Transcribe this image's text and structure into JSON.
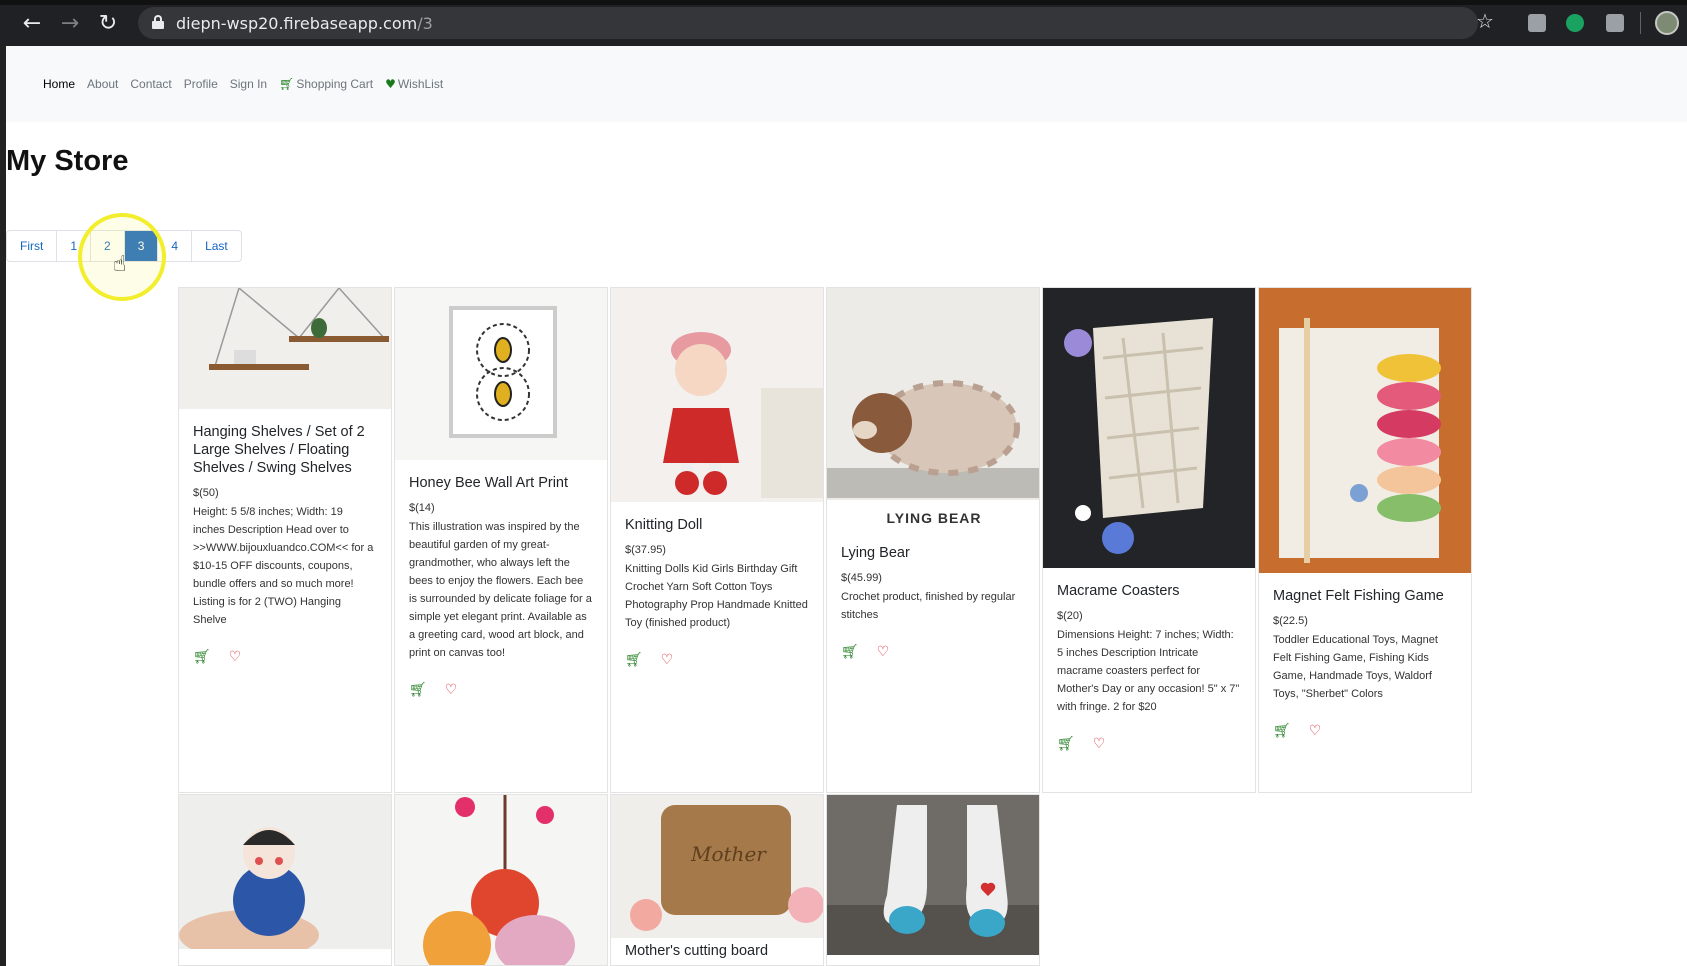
{
  "browser": {
    "url_host": "diepn-wsp20.firebaseapp.com",
    "url_path": "/3"
  },
  "nav": {
    "items": [
      "Home",
      "About",
      "Contact",
      "Profile",
      "Sign In"
    ],
    "cart_label": "Shopping Cart",
    "wishlist_label": "WishList"
  },
  "page": {
    "title": "My Store"
  },
  "pagination": {
    "first": "First",
    "pages": [
      "1",
      "2",
      "3",
      "4"
    ],
    "current": "3",
    "last": "Last"
  },
  "products": [
    {
      "name": "Hanging Shelves / Set of 2 Large Shelves / Floating Shelves / Swing Shelves",
      "price": "$(50)",
      "description": "Height: 5 5/8 inches; Width: 19 inches Description Head over to >>WWW.bijouxluandco.COM<< for a $10-15 OFF discounts, coupons, bundle offers and so much more! Listing is for 2 (TWO) Hanging Shelve"
    },
    {
      "name": "Honey Bee Wall Art Print",
      "price": "$(14)",
      "description": "This illustration was inspired by the beautiful garden of my great-grandmother, who always left the bees to enjoy the flowers. Each bee is surrounded by delicate foliage for a simple yet elegant print. Available as a greeting card, wood art block, and print on canvas too!"
    },
    {
      "name": "Knitting Doll",
      "price": "$(37.95)",
      "description": "Knitting Dolls Kid Girls Birthday Gift Crochet Yarn Soft Cotton Toys Photography Prop Handmade Knitted Toy (finished product)"
    },
    {
      "name": "Lying Bear",
      "price": "$(45.99)",
      "description": "Crochet product, finished by regular stitches",
      "image_caption": "LYING BEAR"
    },
    {
      "name": "Macrame Coasters",
      "price": "$(20)",
      "description": "Dimensions Height: 7 inches; Width: 5 inches Description Intricate macrame coasters perfect for Mother's Day or any occasion! 5\" x 7\" with fringe. 2 for $20"
    },
    {
      "name": "Magnet Felt Fishing Game",
      "price": "$(22.5)",
      "description": "Toddler Educational Toys, Magnet Felt Fishing Game, Fishing Kids Game, Handmade Toys, Waldorf Toys, \"Sherbet\" Colors"
    }
  ],
  "second_row": [
    {
      "name": ""
    },
    {
      "name": ""
    },
    {
      "name": "Mother's cutting board"
    },
    {
      "name": ""
    }
  ],
  "icons": {
    "cart": "shopping-cart-icon",
    "wishlist": "heart-icon"
  },
  "colors": {
    "accent": "#1565c0",
    "cart_green": "#1a7a1a",
    "heart_red": "#d9232d"
  }
}
